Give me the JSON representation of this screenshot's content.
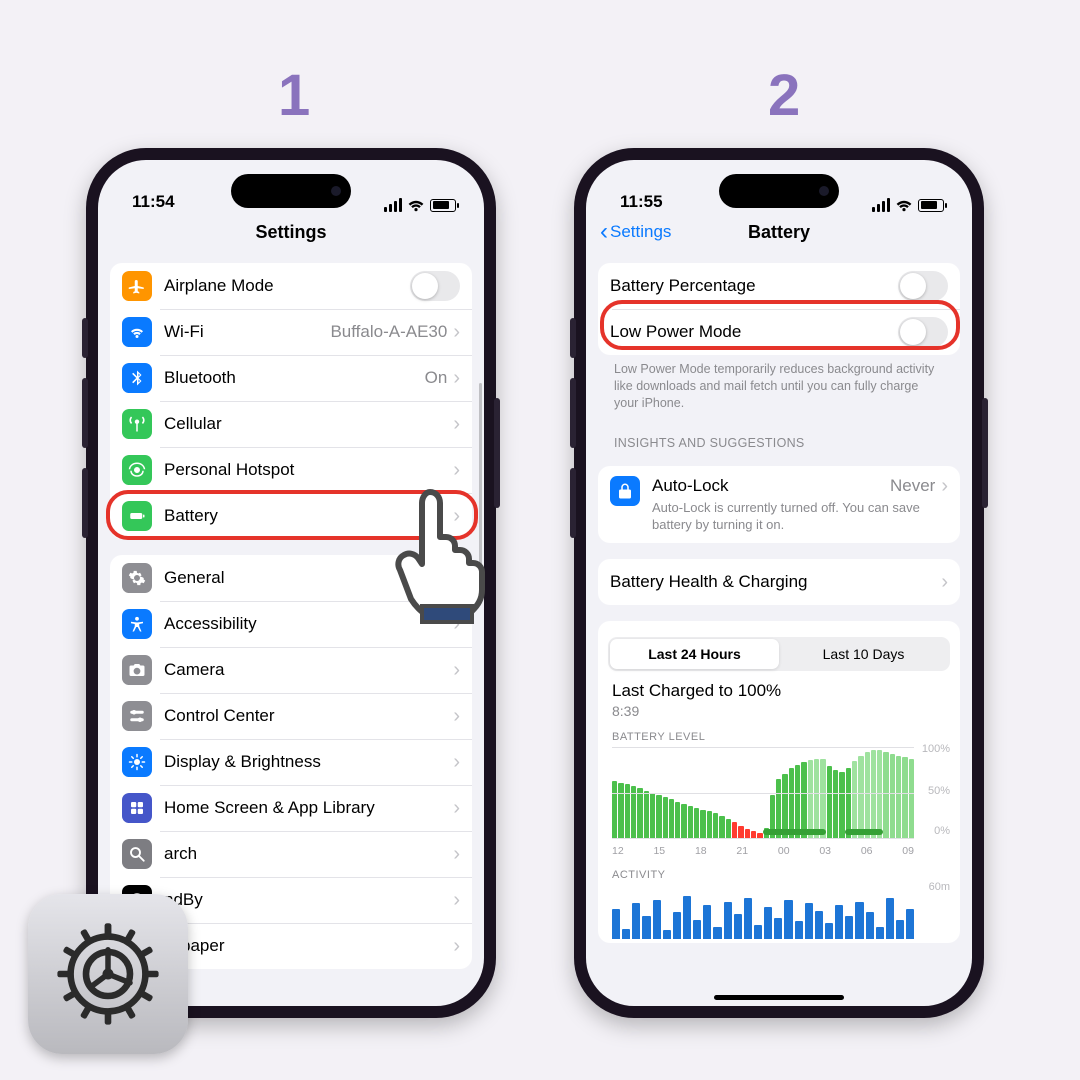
{
  "steps": {
    "one": "1",
    "two": "2"
  },
  "status": {
    "time1": "11:54",
    "time2": "11:55"
  },
  "phone1": {
    "title": "Settings",
    "group1": [
      {
        "icon": "airplane",
        "color": "#ff9500",
        "label": "Airplane Mode",
        "toggle": true
      },
      {
        "icon": "wifi",
        "color": "#0a7aff",
        "label": "Wi-Fi",
        "detail": "Buffalo-A-AE30"
      },
      {
        "icon": "bluetooth",
        "color": "#0a7aff",
        "label": "Bluetooth",
        "detail": "On"
      },
      {
        "icon": "cellular",
        "color": "#34c759",
        "label": "Cellular"
      },
      {
        "icon": "hotspot",
        "color": "#34c759",
        "label": "Personal Hotspot"
      },
      {
        "icon": "battery",
        "color": "#34c759",
        "label": "Battery"
      }
    ],
    "group2": [
      {
        "icon": "general",
        "color": "#8e8e93",
        "label": "General"
      },
      {
        "icon": "accessibility",
        "color": "#0a7aff",
        "label": "Accessibility"
      },
      {
        "icon": "camera",
        "color": "#8e8e93",
        "label": "Camera"
      },
      {
        "icon": "controlcenter",
        "color": "#8e8e93",
        "label": "Control Center"
      },
      {
        "icon": "display",
        "color": "#0a7aff",
        "label": "Display & Brightness"
      },
      {
        "icon": "homescreen",
        "color": "#4556c9",
        "label": "Home Screen & App Library"
      },
      {
        "icon": "search",
        "color": "#7d7d82",
        "label": "arch"
      },
      {
        "icon": "standby",
        "color": "#000000",
        "label": "ndBy"
      },
      {
        "icon": "wallpaper",
        "color": "#27bdd1",
        "label": "allpaper"
      }
    ]
  },
  "phone2": {
    "back": "Settings",
    "title": "Battery",
    "rows": {
      "percentage": "Battery Percentage",
      "lpm": "Low Power Mode",
      "lpm_desc": "Low Power Mode temporarily reduces background activity like downloads and mail fetch until you can fully charge your iPhone.",
      "insights_header": "INSIGHTS AND SUGGESTIONS",
      "autolock": "Auto-Lock",
      "autolock_value": "Never",
      "autolock_desc": "Auto-Lock is currently turned off. You can save battery by turning it on.",
      "health": "Battery Health & Charging",
      "seg1": "Last 24 Hours",
      "seg2": "Last 10 Days",
      "charged_title": "Last Charged to 100%",
      "charged_time": "8:39",
      "level_label": "BATTERY LEVEL",
      "activity_label": "ACTIVITY",
      "y100": "100%",
      "y50": "50%",
      "y0": "0%",
      "a60": "60m"
    },
    "xaxis": [
      "12",
      "15",
      "18",
      "21",
      "00",
      "03",
      "06",
      "09"
    ]
  },
  "chart_data": {
    "battery_level": {
      "type": "bar",
      "title": "BATTERY LEVEL",
      "ylabel": "%",
      "ylim": [
        0,
        100
      ],
      "x": [
        "12",
        "15",
        "18",
        "21",
        "00",
        "03",
        "06",
        "09"
      ],
      "values": [
        64,
        62,
        60,
        58,
        56,
        53,
        50,
        48,
        46,
        44,
        41,
        38,
        36,
        34,
        32,
        30,
        28,
        25,
        22,
        18,
        14,
        11,
        8,
        6,
        12,
        48,
        66,
        72,
        78,
        82,
        85,
        87,
        88,
        88,
        80,
        76,
        74,
        78,
        86,
        92,
        96,
        98,
        98,
        96,
        94,
        92,
        90,
        88
      ],
      "low_power_range": [
        19,
        24
      ],
      "charging_segments": [
        [
          24,
          34
        ],
        [
          37,
          43
        ]
      ]
    },
    "activity": {
      "type": "bar",
      "title": "ACTIVITY",
      "ylabel": "minutes",
      "ylim": [
        0,
        60
      ],
      "x": [
        "12",
        "15",
        "18",
        "21",
        "00",
        "03",
        "06",
        "09"
      ],
      "values": [
        34,
        12,
        40,
        26,
        44,
        10,
        30,
        48,
        22,
        38,
        14,
        42,
        28,
        46,
        16,
        36,
        24,
        44,
        20,
        40,
        32,
        18,
        38,
        26,
        42,
        30,
        14,
        46,
        22,
        34
      ]
    }
  }
}
